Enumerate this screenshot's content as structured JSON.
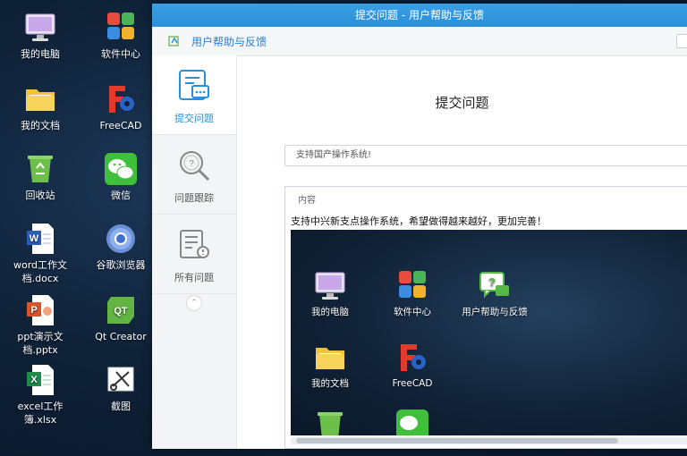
{
  "desktop": {
    "icons": [
      {
        "label": "我的电脑",
        "icon": "computer-icon"
      },
      {
        "label": "软件中心",
        "icon": "software-center-icon"
      },
      {
        "label": "我的文档",
        "icon": "folder-icon"
      },
      {
        "label": "FreeCAD",
        "icon": "freecad-icon"
      },
      {
        "label": "回收站",
        "icon": "recycle-bin-icon"
      },
      {
        "label": "微信",
        "icon": "wechat-icon"
      },
      {
        "label": "word工作文档.docx",
        "icon": "word-doc-icon"
      },
      {
        "label": "谷歌浏览器",
        "icon": "chrome-icon"
      },
      {
        "label": "ppt演示文档.pptx",
        "icon": "ppt-doc-icon"
      },
      {
        "label": "Qt Creator",
        "icon": "qt-creator-icon"
      },
      {
        "label": "excel工作簿.xlsx",
        "icon": "excel-doc-icon"
      },
      {
        "label": "截图",
        "icon": "screenshot-icon"
      }
    ]
  },
  "window": {
    "title": "提交问题 - 用户帮助与反馈",
    "app_name": "用户帮助与反馈"
  },
  "sidebar": {
    "items": [
      {
        "label": "提交问题",
        "icon": "submit-issue-icon",
        "active": true
      },
      {
        "label": "问题跟踪",
        "icon": "issue-search-icon",
        "active": false
      },
      {
        "label": "所有问题",
        "icon": "all-issues-icon",
        "active": false
      }
    ],
    "collapse_glyph": "⌃"
  },
  "main": {
    "page_title": "提交问题",
    "title_input_value": "支持国产操作系统!",
    "content_label": "内容",
    "content_text": "支持中兴新支点操作系统，希望做得越来越好，更加完善！",
    "screenshot_icons": [
      {
        "label": "我的电脑"
      },
      {
        "label": "软件中心"
      },
      {
        "label": "用户帮助与反馈"
      },
      {
        "label": "我的文档"
      },
      {
        "label": "FreeCAD"
      }
    ]
  },
  "colors": {
    "accent": "#2b8fd8",
    "titlebar": "#3aa0e4"
  }
}
